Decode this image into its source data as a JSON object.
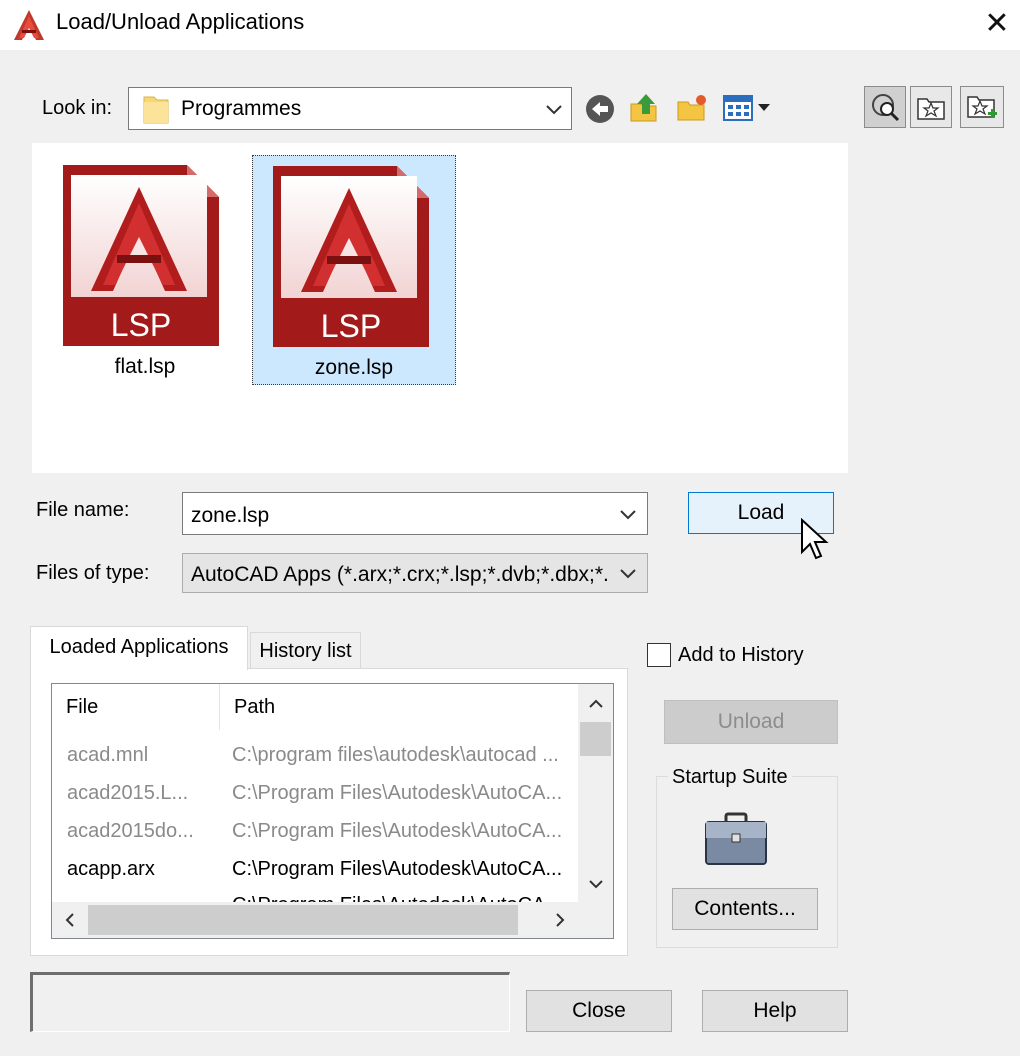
{
  "window": {
    "title": "Load/Unload Applications",
    "close_glyph": "✕"
  },
  "lookin": {
    "label": "Look in:",
    "value": "Programmes"
  },
  "toolbar": {
    "icons": [
      "back-icon",
      "up-folder-icon",
      "new-folder-icon",
      "views-menu-icon"
    ],
    "right_icons": [
      "search-web-icon",
      "favorites-icon",
      "add-favorites-icon"
    ]
  },
  "files": [
    {
      "name": "flat.lsp",
      "badge": "LSP",
      "selected": false
    },
    {
      "name": "zone.lsp",
      "badge": "LSP",
      "selected": true
    }
  ],
  "file_name": {
    "label": "File name:",
    "value": "zone.lsp"
  },
  "files_of_type": {
    "label": "Files of type:",
    "value": "AutoCAD Apps (*.arx;*.crx;*.lsp;*.dvb;*.dbx;*."
  },
  "buttons": {
    "load": "Load",
    "unload": "Unload",
    "contents": "Contents...",
    "close": "Close",
    "help": "Help"
  },
  "tabs": {
    "loaded": "Loaded Applications",
    "history": "History list"
  },
  "table": {
    "columns": [
      "File",
      "Path"
    ],
    "rows": [
      {
        "file": "acad.mnl",
        "path": "C:\\program files\\autodesk\\autocad ...",
        "dim": true
      },
      {
        "file": "acad2015.L...",
        "path": "C:\\Program Files\\Autodesk\\AutoCA...",
        "dim": true
      },
      {
        "file": "acad2015do...",
        "path": "C:\\Program Files\\Autodesk\\AutoCA...",
        "dim": true
      },
      {
        "file": "acapp.arx",
        "path": "C:\\Program Files\\Autodesk\\AutoCA...",
        "dim": false
      },
      {
        "file": "",
        "path": "C:\\Program Files\\Autodesk\\AutoCA...",
        "dim": false
      }
    ]
  },
  "add_to_history": {
    "label": "Add to History",
    "checked": false
  },
  "startup_suite": {
    "label": "Startup Suite"
  },
  "colors": {
    "autocad_red": "#b11c1c",
    "selection": "#cce8ff",
    "accent": "#0078d7"
  }
}
